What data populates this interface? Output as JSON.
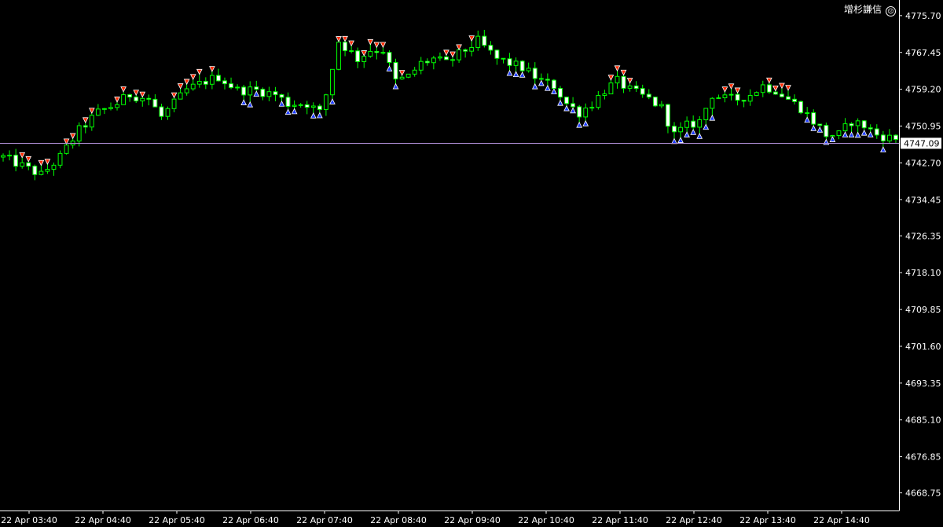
{
  "indicator": {
    "label": "增杉謙信",
    "icon": "frown-face-icon"
  },
  "colors": {
    "background": "#000000",
    "axis": "#ffffff",
    "candle_up": "#00ff00",
    "candle_down": "#ffffff",
    "price_line": "#b08fd8",
    "sell_marker": "#ff2a00",
    "buy_marker": "#1e3cff"
  },
  "chart_data": {
    "type": "candlestick",
    "title": "",
    "ylim": [
      4664.8,
      4779.2
    ],
    "y_ticks": [
      "4775.70",
      "4767.45",
      "4759.20",
      "4750.95",
      "4742.70",
      "4734.45",
      "4726.35",
      "4718.10",
      "4709.85",
      "4701.60",
      "4693.35",
      "4685.10",
      "4676.85",
      "4668.75"
    ],
    "x_labels": [
      "22 Apr 03:40",
      "22 Apr 04:40",
      "22 Apr 05:40",
      "22 Apr 06:40",
      "22 Apr 07:40",
      "22 Apr 08:40",
      "22 Apr 09:40",
      "22 Apr 10:40",
      "22 Apr 11:40",
      "22 Apr 12:40",
      "22 Apr 13:40",
      "22 Apr 14:40"
    ],
    "current_price": "4747.09",
    "close_path": [
      [
        0,
        4744
      ],
      [
        3,
        4742
      ],
      [
        6,
        4740
      ],
      [
        9,
        4744
      ],
      [
        12,
        4750
      ],
      [
        15,
        4754
      ],
      [
        18,
        4756
      ],
      [
        20,
        4758
      ],
      [
        23,
        4757
      ],
      [
        25,
        4753
      ],
      [
        27,
        4756
      ],
      [
        29,
        4759
      ],
      [
        32,
        4761
      ],
      [
        34,
        4762
      ],
      [
        37,
        4759
      ],
      [
        40,
        4759
      ],
      [
        43,
        4758
      ],
      [
        45,
        4756
      ],
      [
        48,
        4756
      ],
      [
        50,
        4754
      ],
      [
        51,
        4758
      ],
      [
        53,
        4770
      ],
      [
        56,
        4766
      ],
      [
        58,
        4768
      ],
      [
        60,
        4768
      ],
      [
        62,
        4761
      ],
      [
        64,
        4762
      ],
      [
        66,
        4765
      ],
      [
        68,
        4766
      ],
      [
        70,
        4765
      ],
      [
        73,
        4768
      ],
      [
        75,
        4770
      ],
      [
        78,
        4766
      ],
      [
        80,
        4765
      ],
      [
        82,
        4764
      ],
      [
        85,
        4761
      ],
      [
        87,
        4760
      ],
      [
        89,
        4756
      ],
      [
        91,
        4754
      ],
      [
        93,
        4756
      ],
      [
        95,
        4759
      ],
      [
        97,
        4761
      ],
      [
        99,
        4759
      ],
      [
        102,
        4757
      ],
      [
        104,
        4755
      ],
      [
        106,
        4749
      ],
      [
        108,
        4751
      ],
      [
        110,
        4752
      ],
      [
        112,
        4758
      ],
      [
        114,
        4757
      ],
      [
        116,
        4757
      ],
      [
        118,
        4758
      ],
      [
        120,
        4760
      ],
      [
        122,
        4759
      ],
      [
        124,
        4757
      ],
      [
        126,
        4755
      ],
      [
        128,
        4752
      ],
      [
        130,
        4749
      ],
      [
        132,
        4749
      ],
      [
        134,
        4752
      ],
      [
        136,
        4751
      ],
      [
        138,
        4749
      ],
      [
        141,
        4748
      ]
    ],
    "sell_arrow_positions": [
      3,
      4,
      6,
      7,
      10,
      11,
      13,
      14,
      18,
      19,
      21,
      22,
      27,
      28,
      29,
      30,
      31,
      33,
      53,
      54,
      55,
      57,
      58,
      59,
      60,
      63,
      70,
      71,
      72,
      74,
      96,
      97,
      98,
      99,
      114,
      115,
      116,
      121,
      122,
      123,
      124
    ],
    "buy_arrow_positions": [
      38,
      39,
      40,
      44,
      45,
      46,
      49,
      50,
      52,
      61,
      62,
      80,
      81,
      82,
      84,
      85,
      86,
      87,
      88,
      89,
      90,
      91,
      92,
      106,
      107,
      108,
      109,
      110,
      111,
      112,
      127,
      128,
      129,
      130,
      131,
      133,
      134,
      135,
      136,
      137,
      139
    ]
  }
}
